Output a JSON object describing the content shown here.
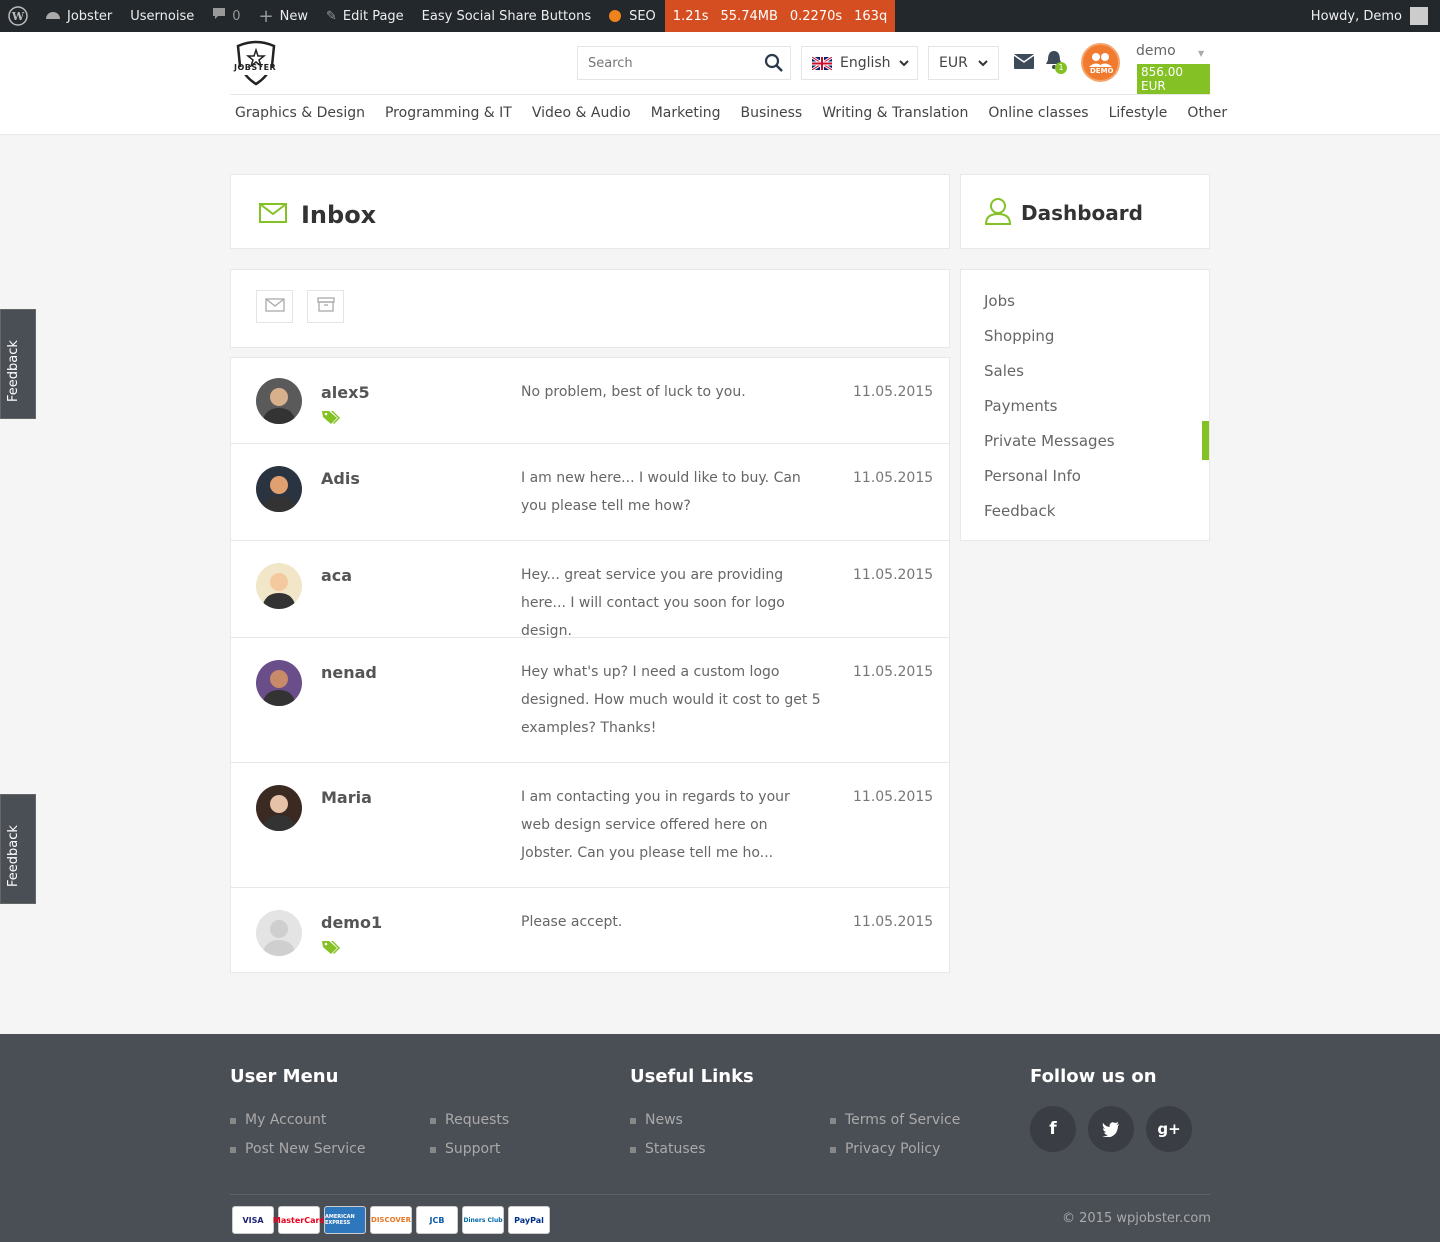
{
  "adminbar": {
    "site": "Jobster",
    "usernoise": "Usernoise",
    "comments": "0",
    "new": "New",
    "edit_page": "Edit Page",
    "social": "Easy Social Share Buttons",
    "seo": "SEO",
    "perf_time": "1.21s",
    "perf_mem": "55.74MB",
    "perf_query_time": "0.2270s",
    "perf_queries": "163q",
    "howdy": "Howdy, Demo"
  },
  "header": {
    "logo_text": "JOBSTER",
    "search_placeholder": "Search",
    "language": "English",
    "currency": "EUR",
    "notifications_count": "1",
    "avatar_label": "DEMO",
    "username": "demo",
    "balance": "856.00 EUR"
  },
  "categories": [
    "Graphics & Design",
    "Programming & IT",
    "Video & Audio",
    "Marketing",
    "Business",
    "Writing & Translation",
    "Online classes",
    "Lifestyle",
    "Other"
  ],
  "inbox": {
    "title": "Inbox",
    "messages": [
      {
        "name": "alex5",
        "text": "No problem, best of luck to you.",
        "date": "11.05.2015",
        "tag": true
      },
      {
        "name": "Adis",
        "text": "I am new here... I would like to buy. Can you please tell me how?",
        "date": "11.05.2015",
        "tag": false
      },
      {
        "name": "aca",
        "text": "Hey... great service you are providing here... I will contact you soon for logo design.",
        "date": "11.05.2015",
        "tag": false
      },
      {
        "name": "nenad",
        "text": "Hey what's up? I need a custom logo designed. How much would it cost to get 5 examples? Thanks!",
        "date": "11.05.2015",
        "tag": false
      },
      {
        "name": "Maria",
        "text": "I am contacting you in regards to your web design service offered here on Jobster. Can you please tell me ho...",
        "date": "11.05.2015",
        "tag": false
      },
      {
        "name": "demo1",
        "text": "Please accept.",
        "date": "11.05.2015",
        "tag": true
      }
    ]
  },
  "dashboard": {
    "title": "Dashboard",
    "items": [
      "Jobs",
      "Shopping",
      "Sales",
      "Payments",
      "Private Messages",
      "Personal Info",
      "Feedback"
    ],
    "active": "Private Messages"
  },
  "feedback_tab": "Feedback",
  "footer": {
    "user_menu_title": "User Menu",
    "user_menu": [
      "My Account",
      "Requests",
      "Post New Service",
      "Support"
    ],
    "useful_title": "Useful Links",
    "useful": [
      "News",
      "Terms of Service",
      "Statuses",
      "Privacy Policy"
    ],
    "follow_title": "Follow us on",
    "cards": [
      "VISA",
      "MasterCard",
      "AMERICAN EXPRESS",
      "DISCOVER",
      "JCB",
      "Diners Club",
      "PayPal"
    ],
    "copyright": "© 2015 wpjobster.com"
  },
  "colors": {
    "accent": "#83c124",
    "adminbar": "#23282d",
    "perf": "#d54e21",
    "footer": "#4a4e55"
  }
}
